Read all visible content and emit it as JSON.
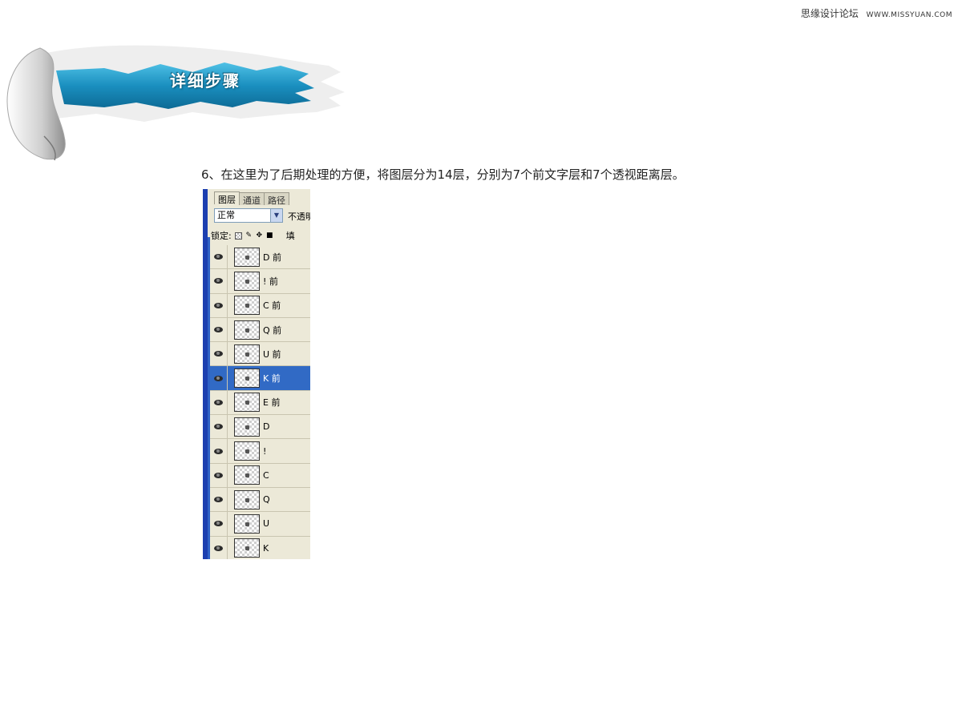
{
  "site": {
    "name": "思缘设计论坛",
    "url": "WWW.MISSYUAN.COM"
  },
  "banner": {
    "title": "详细步骤"
  },
  "step": {
    "text": "6、在这里为了后期处理的方便，将图层分为14层，分别为7个前文字层和7个透视距离层。"
  },
  "layers_panel": {
    "tabs": [
      {
        "label": "图层"
      },
      {
        "label": "通道"
      },
      {
        "label": "路径"
      }
    ],
    "blend_mode": "正常",
    "opacity_label": "不透明",
    "lock_label": "锁定:",
    "fill_label": "填",
    "layers": [
      {
        "name": "D 前",
        "selected": false
      },
      {
        "name": "! 前",
        "selected": false
      },
      {
        "name": "C 前",
        "selected": false
      },
      {
        "name": "Q 前",
        "selected": false
      },
      {
        "name": "U 前",
        "selected": false
      },
      {
        "name": "K 前",
        "selected": true
      },
      {
        "name": "E 前",
        "selected": false
      },
      {
        "name": "D",
        "selected": false
      },
      {
        "name": "!",
        "selected": false
      },
      {
        "name": "C",
        "selected": false
      },
      {
        "name": "Q",
        "selected": false
      },
      {
        "name": "U",
        "selected": false
      },
      {
        "name": "K",
        "selected": false
      }
    ],
    "colors": {
      "panel_bg": "#ece9d8",
      "selected_bg": "#316ac5",
      "border_blue": "#1c3fb0"
    }
  },
  "colors": {
    "banner_blue": "#1a8fbf"
  }
}
